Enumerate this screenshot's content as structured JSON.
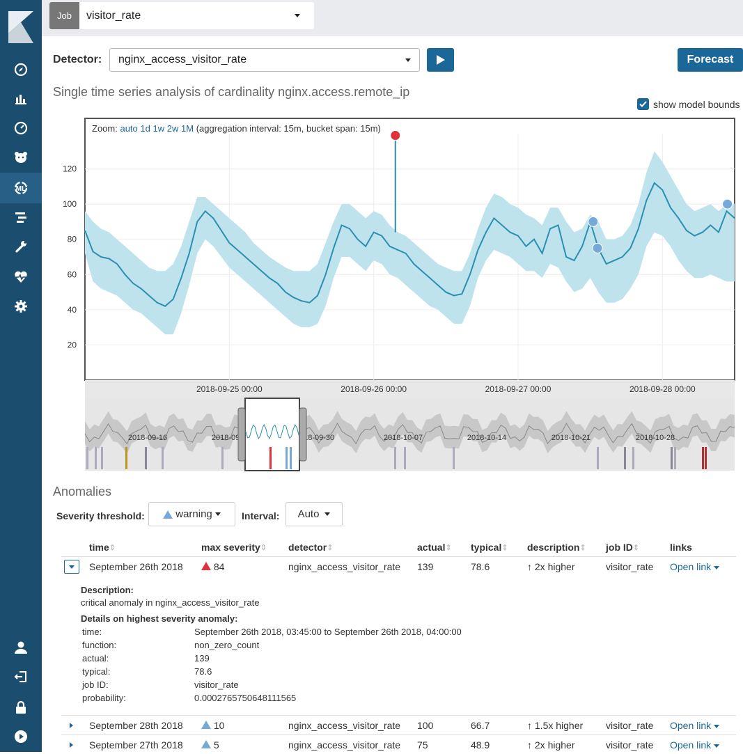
{
  "topbar": {
    "job_tag": "Job",
    "job_value": "visitor_rate"
  },
  "controls": {
    "detector_label": "Detector:",
    "detector_value": "nginx_access_visitor_rate",
    "forecast_label": "Forecast"
  },
  "page_title": "Single time series analysis of cardinality nginx.access.remote_ip",
  "show_model_bounds": {
    "label": "show model bounds",
    "checked": true
  },
  "chart_data": {
    "type": "line",
    "zoom_label": "Zoom:",
    "zoom_options": [
      "auto",
      "1d",
      "1w",
      "2w",
      "1M"
    ],
    "zoom_note": "(aggregation interval: 15m, bucket span: 15m)",
    "yticks": [
      20,
      40,
      60,
      80,
      100,
      120
    ],
    "ylim": [
      0,
      140
    ],
    "xticks": [
      "2018-09-25 00:00",
      "2018-09-26 00:00",
      "2018-09-27 00:00",
      "2018-09-28 00:00"
    ],
    "xlim_days": [
      0,
      4.5
    ],
    "series": [
      {
        "name": "actual",
        "values": [
          85,
          73,
          70,
          69,
          66,
          60,
          55,
          52,
          48,
          44,
          42,
          46,
          58,
          72,
          90,
          96,
          92,
          85,
          78,
          74,
          70,
          66,
          62,
          58,
          55,
          50,
          47,
          45,
          44,
          48,
          60,
          75,
          88,
          86,
          80,
          76,
          84,
          82,
          76,
          74,
          72,
          66,
          62,
          58,
          54,
          50,
          48,
          49,
          60,
          74,
          84,
          92,
          88,
          84,
          82,
          76,
          80,
          72,
          86,
          88,
          70,
          68,
          76,
          90,
          75,
          66,
          68,
          70,
          75,
          86,
          102,
          112,
          108,
          98,
          92,
          85,
          82,
          84,
          88,
          84,
          96,
          92
        ]
      },
      {
        "name": "upper bound",
        "values": [
          96,
          90,
          86,
          84,
          80,
          76,
          72,
          68,
          64,
          62,
          62,
          66,
          76,
          90,
          104,
          104,
          100,
          96,
          92,
          88,
          84,
          78,
          74,
          70,
          67,
          64,
          62,
          62,
          62,
          66,
          78,
          90,
          100,
          100,
          96,
          92,
          96,
          94,
          88,
          84,
          82,
          78,
          74,
          70,
          66,
          64,
          62,
          62,
          72,
          86,
          98,
          106,
          104,
          100,
          98,
          94,
          92,
          88,
          98,
          98,
          90,
          84,
          86,
          94,
          90,
          80,
          80,
          82,
          88,
          100,
          118,
          130,
          124,
          116,
          108,
          100,
          96,
          98,
          100,
          96,
          100,
          100
        ]
      },
      {
        "name": "lower bound",
        "values": [
          72,
          56,
          52,
          50,
          48,
          44,
          40,
          38,
          34,
          30,
          26,
          26,
          38,
          54,
          72,
          80,
          76,
          70,
          64,
          60,
          56,
          52,
          48,
          44,
          40,
          36,
          32,
          30,
          30,
          32,
          42,
          58,
          70,
          70,
          66,
          62,
          68,
          66,
          60,
          58,
          54,
          50,
          46,
          42,
          40,
          36,
          32,
          32,
          42,
          58,
          68,
          74,
          72,
          70,
          66,
          62,
          62,
          58,
          66,
          64,
          56,
          50,
          52,
          58,
          50,
          44,
          44,
          46,
          52,
          60,
          76,
          84,
          82,
          76,
          68,
          62,
          58,
          58,
          60,
          58,
          56,
          56
        ]
      }
    ],
    "anomalies": [
      {
        "day": 2.15,
        "value": 139,
        "severity": 84
      },
      {
        "day": 3.52,
        "value": 90,
        "severity": 10
      },
      {
        "day": 3.55,
        "value": 75,
        "severity": 5
      },
      {
        "day": 4.45,
        "value": 100,
        "severity": 10
      }
    ],
    "overview_ticks": [
      "2018-09-16",
      "2018-09-23",
      "2018-09-30",
      "2018-10-07",
      "2018-10-14",
      "2018-10-21",
      "2018-10-28"
    ]
  },
  "anomalies": {
    "title": "Anomalies",
    "severity_label": "Severity threshold:",
    "severity_value": "warning",
    "interval_label": "Interval:",
    "interval_value": "Auto",
    "columns": [
      "time",
      "max severity",
      "detector",
      "actual",
      "typical",
      "description",
      "job ID",
      "links"
    ],
    "rows": [
      {
        "time": "September 26th 2018",
        "severity": "84",
        "detector": "nginx_access_visitor_rate",
        "actual": "139",
        "typical": "78.6",
        "description": "2x higher",
        "job_id": "visitor_rate",
        "link": "Open link"
      },
      {
        "time": "September 28th 2018",
        "severity": "10",
        "detector": "nginx_access_visitor_rate",
        "actual": "100",
        "typical": "66.7",
        "description": "1.5x higher",
        "job_id": "visitor_rate",
        "link": "Open link"
      },
      {
        "time": "September 27th 2018",
        "severity": "5",
        "detector": "nginx_access_visitor_rate",
        "actual": "75",
        "typical": "48.9",
        "description": "2x higher",
        "job_id": "visitor_rate",
        "link": "Open link"
      }
    ],
    "details": {
      "description_heading": "Description:",
      "description_text": "critical anomaly in nginx_access_visitor_rate",
      "details_heading": "Details on highest severity anomaly:",
      "fields": [
        {
          "k": "time:",
          "v": "September 26th 2018, 03:45:00 to September 26th 2018, 04:00:00"
        },
        {
          "k": "function:",
          "v": "non_zero_count"
        },
        {
          "k": "actual:",
          "v": "139"
        },
        {
          "k": "typical:",
          "v": "78.6"
        },
        {
          "k": "job ID:",
          "v": "visitor_rate"
        },
        {
          "k": "probability:",
          "v": "0.0002765750648111565"
        }
      ]
    }
  },
  "colors": {
    "sidebar": "#1b4d6e",
    "accent": "#1b6798",
    "bounds": "#bfe3ec",
    "line": "#2a8fb0",
    "critical": "#e0323d",
    "warning": "#77a9d8"
  }
}
